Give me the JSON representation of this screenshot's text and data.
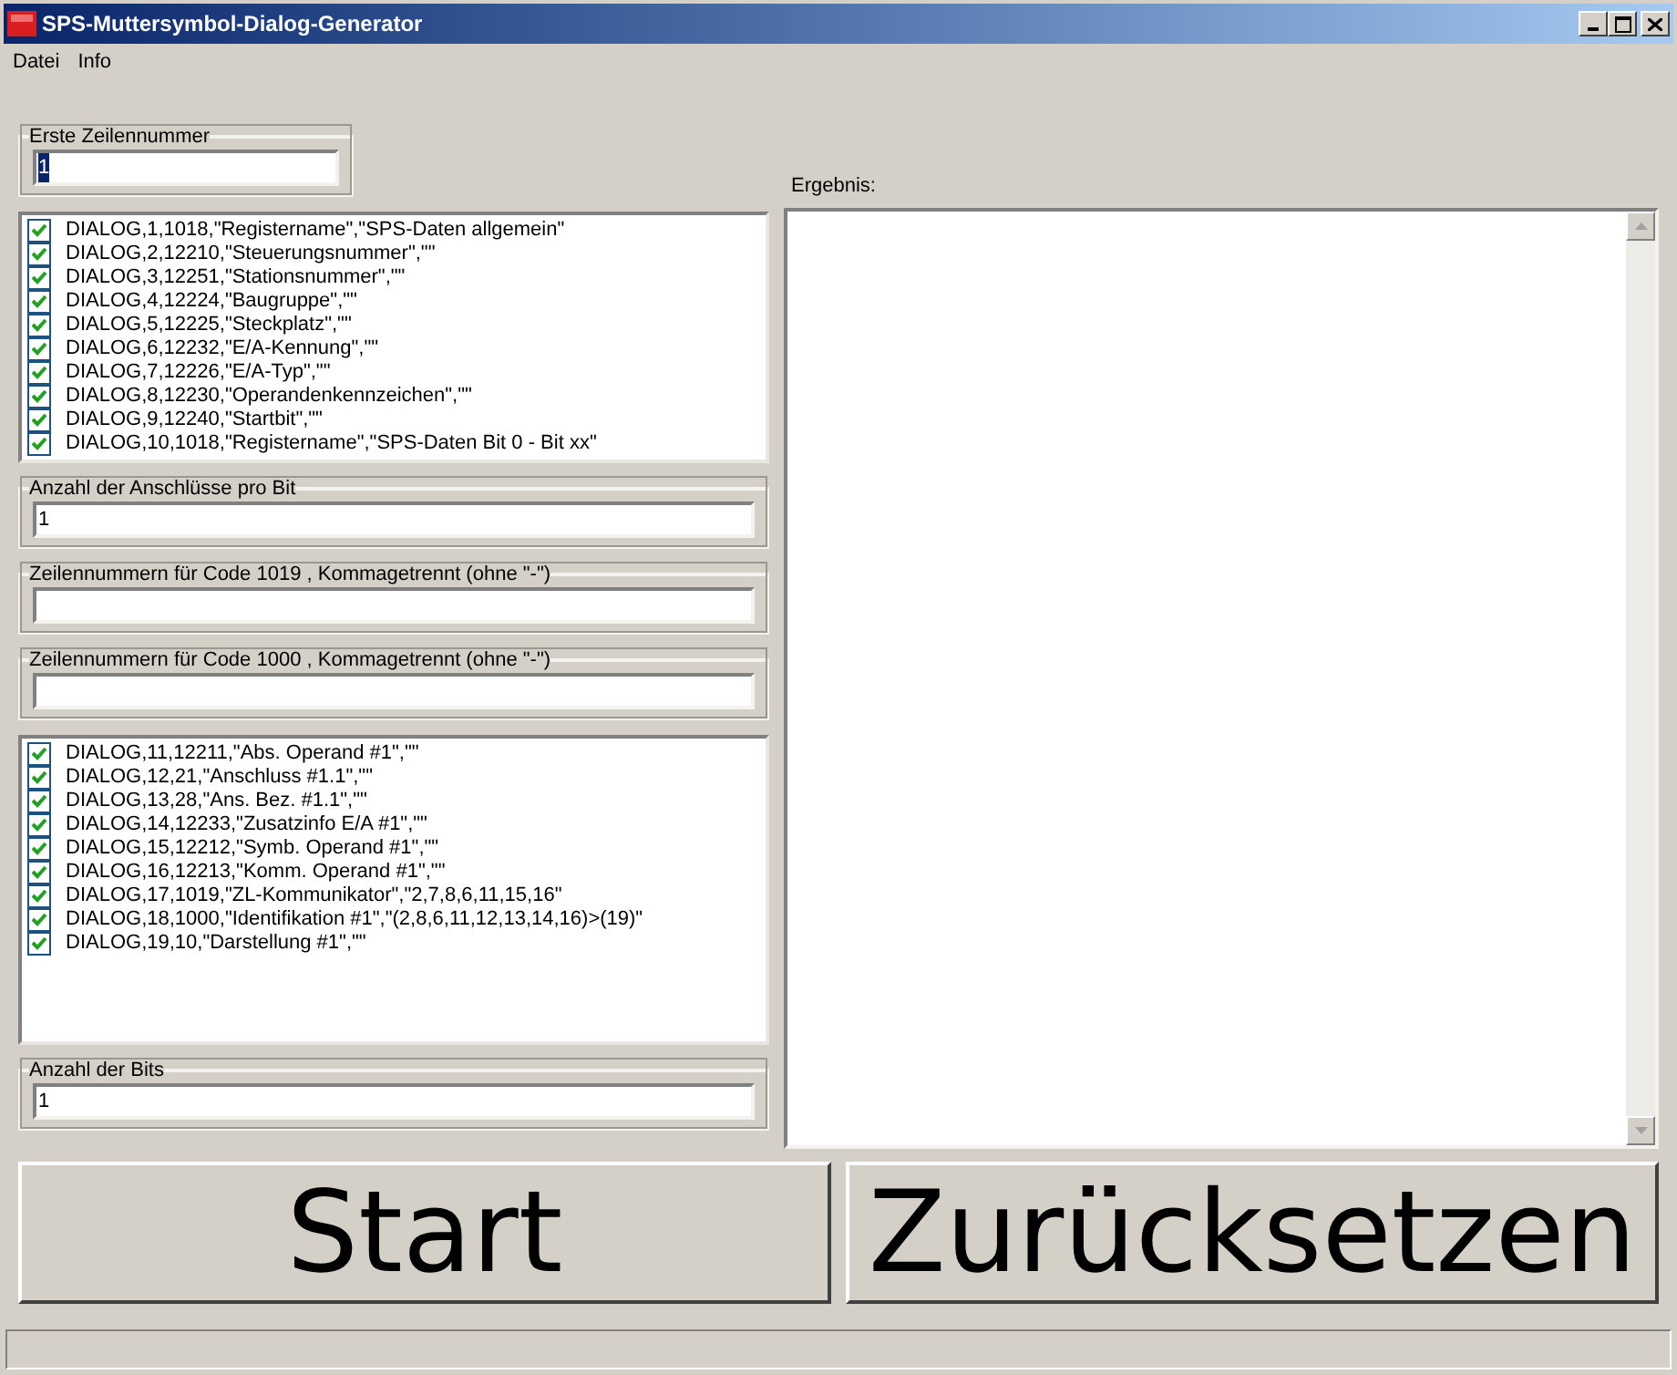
{
  "window": {
    "title": "SPS-Muttersymbol-Dialog-Generator"
  },
  "menu": [
    "Datei",
    "Info"
  ],
  "first_line": {
    "label": "Erste Zeilennummer",
    "value": "1",
    "text_selected": true
  },
  "list_1": [
    {
      "text": "DIALOG,1,1018,\"Registername\",\"SPS-Daten allgemein\"",
      "checked": true
    },
    {
      "text": "DIALOG,2,12210,\"Steuerungsnummer\",\"\"",
      "checked": true
    },
    {
      "text": "DIALOG,3,12251,\"Stationsnummer\",\"\"",
      "checked": true
    },
    {
      "text": "DIALOG,4,12224,\"Baugruppe\",\"\"",
      "checked": true
    },
    {
      "text": "DIALOG,5,12225,\"Steckplatz\",\"\"",
      "checked": true
    },
    {
      "text": "DIALOG,6,12232,\"E/A-Kennung\",\"\"",
      "checked": true
    },
    {
      "text": "DIALOG,7,12226,\"E/A-Typ\",\"\"",
      "checked": true
    },
    {
      "text": "DIALOG,8,12230,\"Operandenkennzeichen\",\"\"",
      "checked": true
    },
    {
      "text": "DIALOG,9,12240,\"Startbit\",\"\"",
      "checked": true
    },
    {
      "text": "DIALOG,10,1018,\"Registername\",\"SPS-Daten Bit 0 - Bit xx\"",
      "checked": true
    }
  ],
  "fields": [
    {
      "label": "Anzahl der Anschlüsse pro Bit",
      "value": "1"
    },
    {
      "label": "Zeilennummern für Code 1019 , Kommagetrennt  (ohne \"-\")"
    },
    {
      "label": "Zeilennummern für Code 1000 , Kommagetrennt  (ohne \"-\")"
    }
  ],
  "list_2": [
    {
      "text": "DIALOG,11,12211,\"Abs. Operand #1\",\"\"",
      "checked": true
    },
    {
      "text": "DIALOG,12,21,\"Anschluss #1.1\",\"\"",
      "checked": true
    },
    {
      "text": "DIALOG,13,28,\"Ans. Bez. #1.1\",\"\"",
      "checked": true
    },
    {
      "text": "DIALOG,14,12233,\"Zusatzinfo E/A #1\",\"\"",
      "checked": true
    },
    {
      "text": "DIALOG,15,12212,\"Symb. Operand #1\",\"\"",
      "checked": true
    },
    {
      "text": "DIALOG,16,12213,\"Komm. Operand #1\",\"\"",
      "checked": true
    },
    {
      "text": "DIALOG,17,1019,\"ZL-Kommunikator\",\"2,7,8,6,11,15,16\"",
      "checked": true
    },
    {
      "text": "DIALOG,18,1000,\"Identifikation #1\",\"(2,8,6,11,12,13,14,16)>(19)\"",
      "checked": true
    },
    {
      "text": "DIALOG,19,10,\"Darstellung #1\",\"\"",
      "checked": true
    }
  ],
  "bits": {
    "label": "Anzahl der Bits",
    "value": "1"
  },
  "result": {
    "label": "Ergebnis:"
  },
  "buttons": [
    "Start",
    "Zurücksetzen"
  ]
}
